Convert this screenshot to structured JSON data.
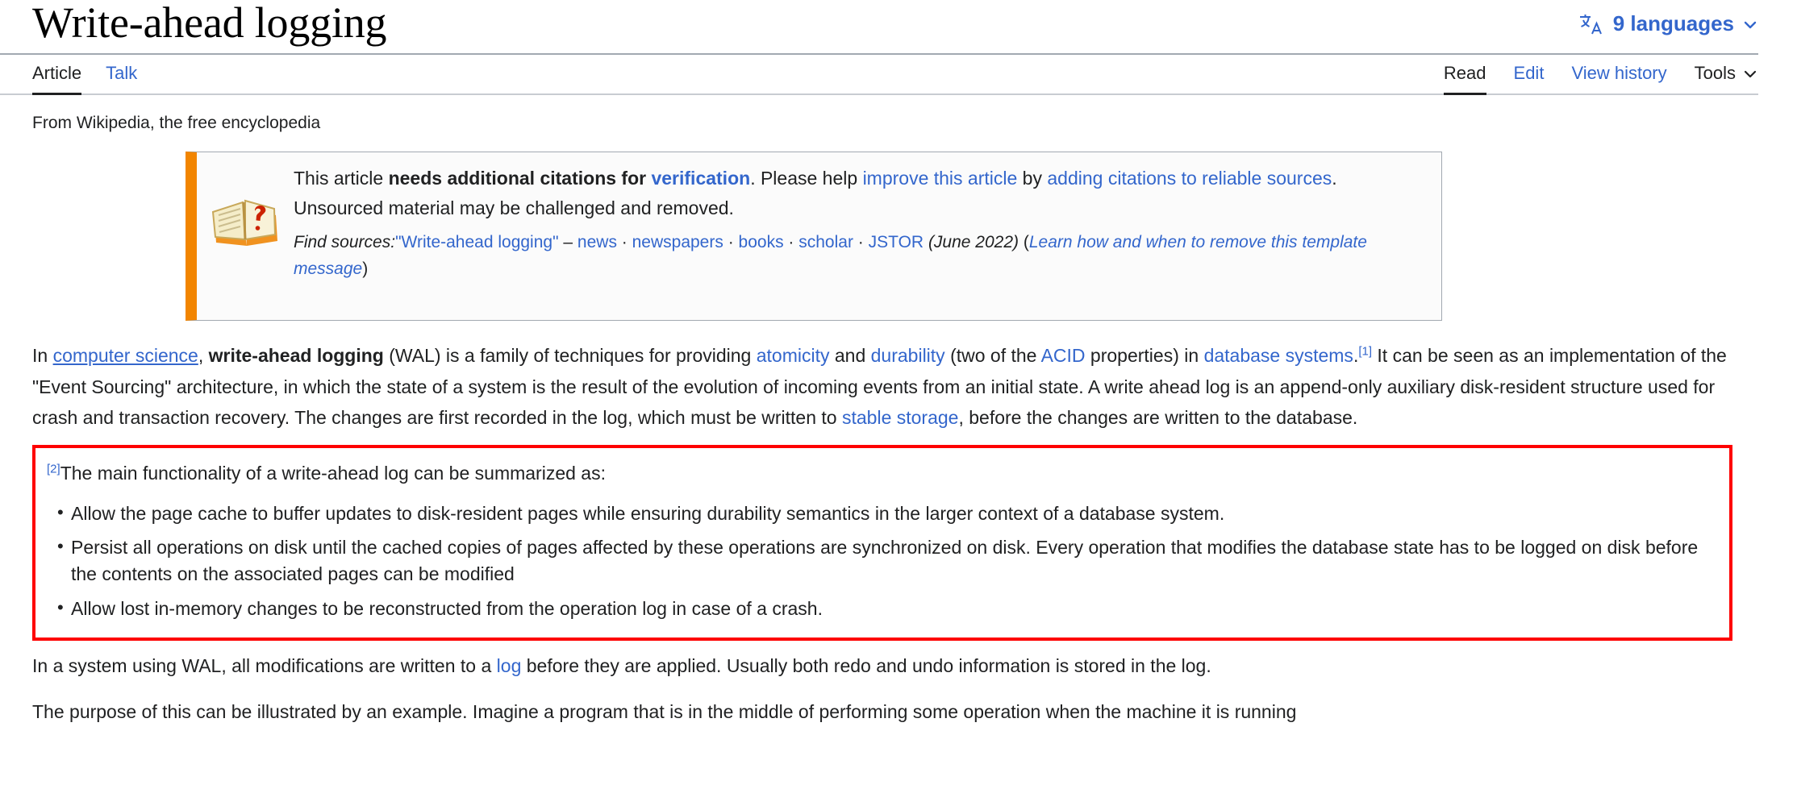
{
  "header": {
    "title": "Write-ahead logging",
    "language_selector": {
      "icon": "translate-icon",
      "label": "9 languages",
      "chevron": "chevron-down-icon"
    }
  },
  "tabs": {
    "left": [
      {
        "label": "Article",
        "selected": true
      },
      {
        "label": "Talk",
        "selected": false
      }
    ],
    "right": [
      {
        "label": "Read",
        "selected": true
      },
      {
        "label": "Edit",
        "selected": false
      },
      {
        "label": "View history",
        "selected": false
      },
      {
        "label": "Tools",
        "selected": false,
        "chevron": "chevron-down-icon"
      }
    ]
  },
  "tagline": "From Wikipedia, the free encyclopedia",
  "ambox": {
    "icon": "book-question-icon",
    "accent_color": "#f28500",
    "line1_a": "This article ",
    "line1_bold": "needs additional citations for ",
    "line1_link_verification": "verification",
    "line1_b": ". Please help ",
    "line1_link_improve": "improve this article",
    "line1_c": " by ",
    "line1_link_adding": "adding citations to reliable sources",
    "line1_d": ". Unsourced material may be challenged and removed.",
    "find_sources_label": "Find sources:",
    "find_sources_query": "\"Write-ahead logging\"",
    "dash": "–",
    "sources": [
      "news",
      "newspapers",
      "books",
      "scholar",
      "JSTOR"
    ],
    "date": "(June 2022)",
    "learn_more": "Learn how and when to remove this template message",
    "paren_open": "(",
    "paren_close": ")"
  },
  "lead_paragraph": {
    "p1_a": "In ",
    "p1_link_cs": "computer science",
    "p1_b": ", ",
    "p1_bold": "write-ahead logging",
    "p1_c": " (WAL) is a family of techniques for providing ",
    "p1_link_atomicity": "atomicity",
    "p1_d": " and ",
    "p1_link_durability": "durability",
    "p1_e": " (two of the ",
    "p1_link_acid": "ACID",
    "p1_f": " properties) in ",
    "p1_link_database": "database systems",
    "p1_ref1": "[1]",
    "p1_g": " It can be seen as an implementation of the \"Event Sourcing\" architecture, in which the state of a system is the result of the evolution of incoming events from an initial state. A write ahead log is an append-only auxiliary disk-resident structure used for crash and transaction recovery. The changes are first recorded in the log, which must be written to ",
    "p1_link_stable": "stable storage",
    "p1_h": ", before the changes are written to the database."
  },
  "highlight_box": {
    "border_color": "#fe0000",
    "ref2": "[2]",
    "lead": "The main functionality of a write-ahead log can be summarized as:",
    "bullets": [
      "Allow the page cache to buffer updates to disk-resident pages while ensuring durability semantics in the larger context of a database system.",
      "Persist all operations on disk until the cached copies of pages affected by these operations are synchronized on disk. Every operation that modifies the database state has to be logged on disk before the contents on the associated pages can be modified",
      "Allow lost in-memory changes to be reconstructed from the operation log in case of a crash."
    ]
  },
  "after_box": {
    "a": "In a system using WAL, all modifications are written to a ",
    "link_log": "log",
    "b": " before they are applied. Usually both redo and undo information is stored in the log."
  },
  "clipped_paragraph": "The purpose of this can be illustrated by an example. Imagine a program that is in the middle of performing some operation when the machine it is running"
}
